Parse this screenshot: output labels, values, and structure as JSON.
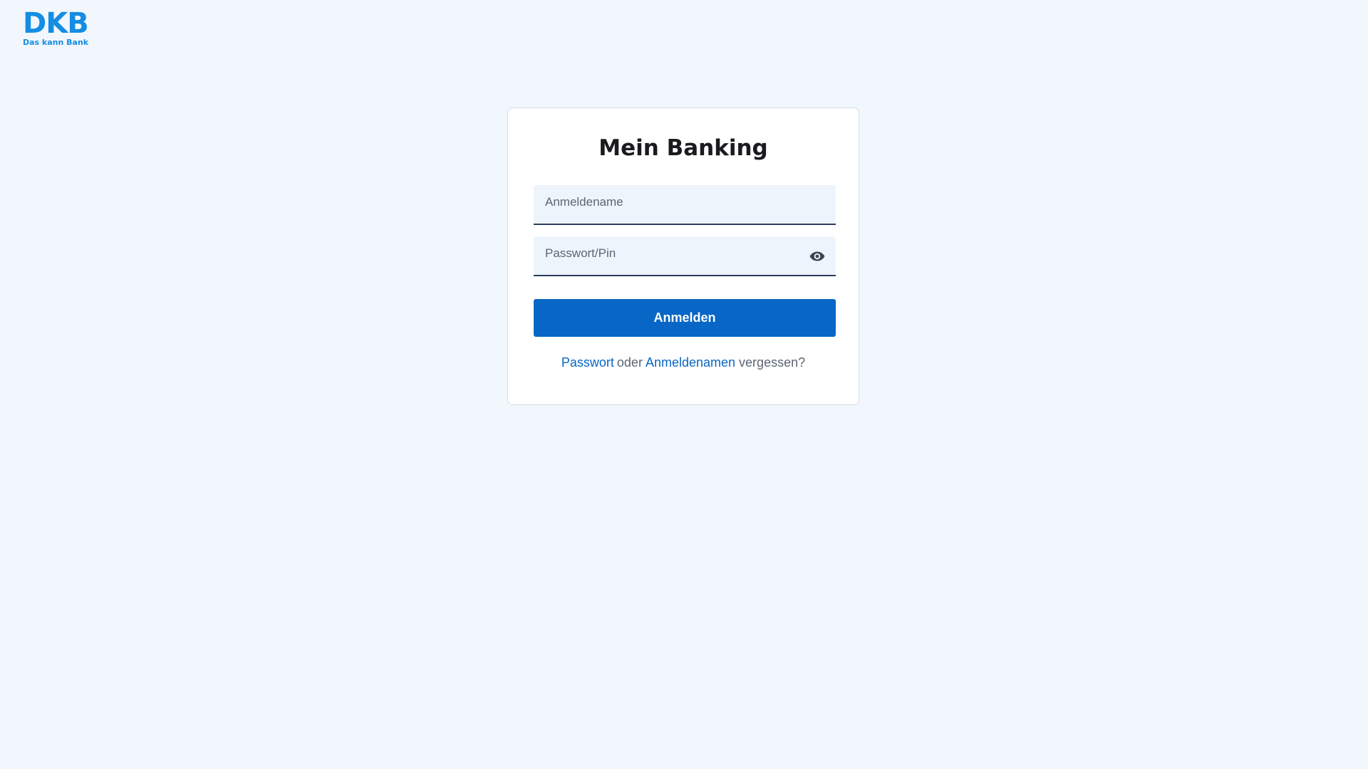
{
  "brand": {
    "mark": "DKB",
    "tagline": "Das kann Bank",
    "color": "#148de2"
  },
  "login": {
    "title": "Mein Banking",
    "username_placeholder": "Anmeldename",
    "username_value": "",
    "password_placeholder": "Passwort/Pin",
    "password_value": "",
    "show_password_icon": "eye-icon",
    "submit_label": "Anmelden",
    "forgot": {
      "password_link": "Passwort",
      "connector": "oder",
      "username_link": "Anmeldenamen",
      "suffix": "vergessen?"
    }
  },
  "colors": {
    "background": "#f2f7fd",
    "primary": "#0866c6",
    "field_background": "#eef4fb"
  }
}
